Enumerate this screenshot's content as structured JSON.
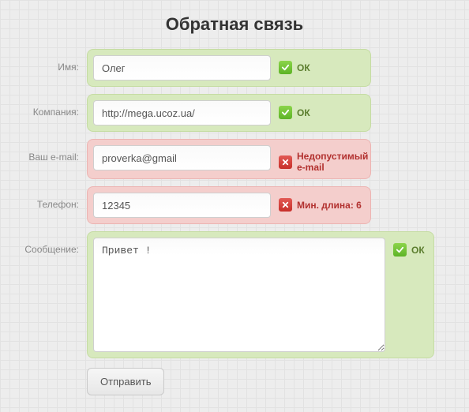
{
  "title": "Обратная связь",
  "fields": {
    "name": {
      "label": "Имя:",
      "value": "Олег",
      "status": "ok",
      "message": "ОК"
    },
    "company": {
      "label": "Компания:",
      "value": "http://mega.ucoz.ua/",
      "status": "ok",
      "message": "ОК"
    },
    "email": {
      "label": "Ваш e-mail:",
      "value": "proverka@gmail",
      "status": "error",
      "message": "Недопустимый e-mail"
    },
    "phone": {
      "label": "Телефон:",
      "value": "12345",
      "status": "error",
      "message": "Мин. длина: 6"
    },
    "message": {
      "label": "Сообщение:",
      "value": "Привет !",
      "status": "ok",
      "message": "ОК"
    }
  },
  "submit_label": "Отправить",
  "colors": {
    "ok_bg": "#d7e9bd",
    "error_bg": "#f4cecc",
    "ok_icon": "#5db326",
    "error_icon": "#c72f2a"
  }
}
